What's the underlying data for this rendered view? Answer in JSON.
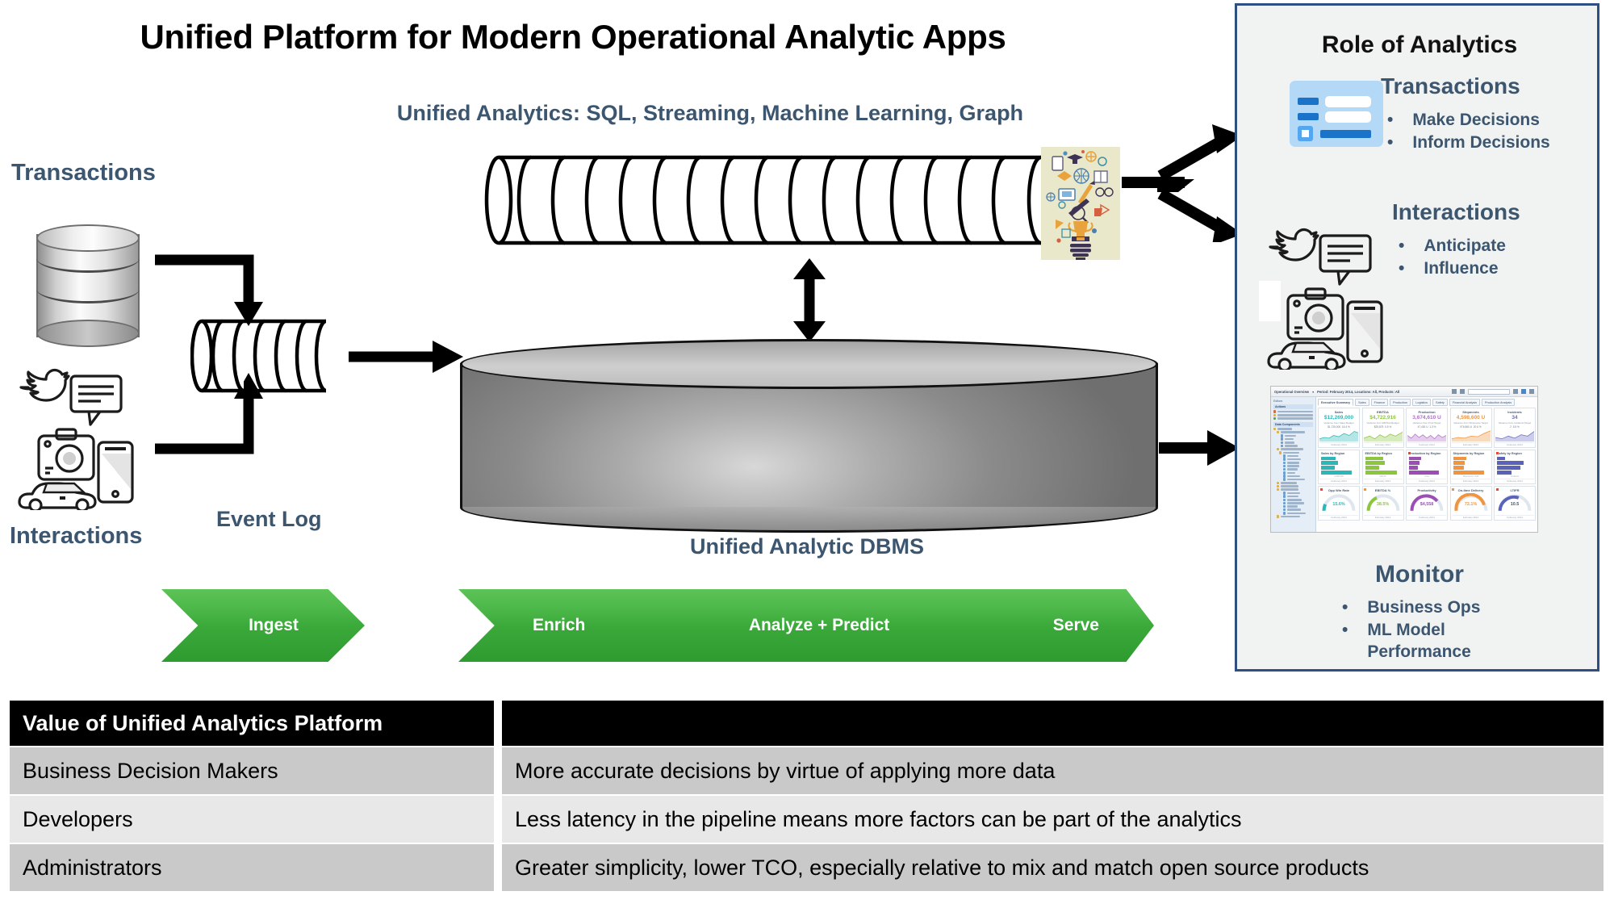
{
  "title": "Unified Platform for Modern Operational Analytic Apps",
  "subtitle": "Unified Analytics: SQL, Streaming, Machine Learning, Graph",
  "flow": {
    "transactions_label": "Transactions",
    "interactions_label": "Interactions",
    "event_log_label": "Event Log",
    "dbms_label": "Unified Analytic DBMS",
    "transactions_icon": "database-cylinder-icon",
    "interactions_icon": "social-devices-cluster-icon",
    "event_log_icon": "coiled-pipe-icon",
    "stream_pipe_icon": "long-coiled-pipe-icon",
    "insight_icon": "lightbulb-ideas-collage-icon",
    "dbms_icon": "large-drum-database-icon"
  },
  "pipeline": {
    "ingest": "Ingest",
    "stages": [
      "Enrich",
      "Analyze + Predict",
      "Serve"
    ]
  },
  "role_panel": {
    "title": "Role of Analytics",
    "sections": [
      {
        "heading": "Transactions",
        "icon": "form-card-icon",
        "bullets": [
          "Make Decisions",
          "Inform Decisions"
        ]
      },
      {
        "heading": "Interactions",
        "icon": "social-devices-cluster-icon",
        "bullets": [
          "Anticipate",
          "Influence"
        ]
      },
      {
        "heading": "Monitor",
        "icon": "dashboard-screenshot-icon",
        "bullets": [
          "Business Ops",
          "ML Model Performance"
        ]
      }
    ]
  },
  "dashboard": {
    "titlebar": "Operational Overview",
    "titlebar_filter": "Period: February 2014, Locations: All, Products: All",
    "search_placeholder": "Search Company",
    "sidebar_title": "Editors",
    "sidebar_groups": [
      {
        "name": "Actions",
        "items": [
          "Copy to Personal Folder",
          "Copy to common folder ...",
          "Publish this component"
        ]
      },
      {
        "name": "Data Components",
        "items": [
          "Metrics",
          "Worldwide Operations Metrics",
          "Quantity",
          "Price",
          "Costs",
          "New LotR",
          "Stepwise World Metrics",
          "Sales Metrics",
          "Backlog",
          "Enquiry Count",
          "Lead Count",
          "Quote Count",
          "Sale Count",
          "Sales",
          "Sales Active",
          "Sales Success Rate",
          "Safety Metrics",
          "Finance Metrics",
          "Logistics Metrics",
          "Deliveries",
          "Inventory",
          "Inventory Days",
          "On-time Deliveries",
          "OTD Target",
          "Shipments",
          "On Time Delivery Rate",
          "Production Metrics"
        ]
      }
    ],
    "tabs": [
      "Executive Summary",
      "Sales",
      "Finance",
      "Production",
      "Logistics",
      "Safety",
      "Financial Analysis",
      "Production Analysis"
    ],
    "active_tab": "Executive Summary",
    "period_label": "February 2014",
    "kpis": [
      {
        "name": "Sales",
        "value": "$12,269,000",
        "color": "#2bb7b7",
        "variance_label": "Variance from Sales Budget",
        "variance_value": "$1,725,000",
        "variance_pct": "16.4 %"
      },
      {
        "name": "EBITDA",
        "value": "$4,722,916",
        "color": "#8cc63f",
        "variance_label": "Variance from EBITDA Budget",
        "variance_value": "$25,875",
        "variance_pct": "0.5 %"
      },
      {
        "name": "Production",
        "value": "3,674,610 U",
        "color": "#b06fc7",
        "variance_label": "Variance from Prod Target",
        "variance_value": "47,430 U",
        "variance_pct": "1.3 %"
      },
      {
        "name": "Shipments",
        "value": "4,598,600 U",
        "color": "#f0953f",
        "variance_label": "Variance from Shipments Target",
        "variance_value": "976,560 U",
        "variance_pct": "20.6 %"
      },
      {
        "name": "Incidents",
        "value": "34",
        "color": "#6a6fc4",
        "variance_label": "Variance from Incidents Target",
        "variance_value": "2",
        "variance_pct": "5.5 %"
      }
    ],
    "region_charts": [
      {
        "name": "Sales by Region",
        "color": "#2bb7b7",
        "bars": [
          42,
          48,
          38,
          86
        ],
        "axis": "2,000,000"
      },
      {
        "name": "EBITDA by Region",
        "color": "#8cc63f",
        "bars": [
          50,
          56,
          40,
          90
        ],
        "axis": "500,00"
      },
      {
        "name": "Production by Region",
        "color": "#9b4fb5",
        "bars": [
          34,
          30,
          26,
          84
        ],
        "axis": "Units"
      },
      {
        "name": "Shipments by Region",
        "color": "#f0953f",
        "bars": [
          38,
          34,
          30,
          88
        ],
        "axis": "Shipments x 100"
      },
      {
        "name": "Safety by Region",
        "color": "#5b62ba",
        "bars": [
          22,
          74,
          66,
          40
        ],
        "axis": "Incidents"
      }
    ],
    "gauges": [
      {
        "name": "Opp Win Rate",
        "value": "15.6%",
        "color": "#2bb7b7",
        "pct": 16
      },
      {
        "name": "EBITDA %",
        "value": "38.5%",
        "color": "#8cc63f",
        "pct": 39
      },
      {
        "name": "Productivity",
        "value": "$4,558",
        "color": "#9b4fb5",
        "pct": 62
      },
      {
        "name": "On-time Delivery",
        "value": "72.1%",
        "color": "#f0953f",
        "pct": 72
      },
      {
        "name": "LTIFR",
        "value": "10.5",
        "color": "#5b62ba",
        "pct": 55
      }
    ]
  },
  "table": {
    "header": [
      "Value of Unified Analytics Platform",
      ""
    ],
    "rows": [
      [
        "Business Decision Makers",
        "More accurate decisions by virtue of applying more data"
      ],
      [
        "Developers",
        "Less latency in the pipeline means more factors can be part of the analytics"
      ],
      [
        "Administrators",
        "Greater simplicity, lower TCO, especially relative to mix and match open source products"
      ]
    ]
  },
  "colors": {
    "slate_text": "#3d5670",
    "panel_border": "#2f4f82",
    "panel_bg": "#f1f2f2",
    "chevron_green": "#3aa93a",
    "card_blue": "#b3d9f7",
    "accent_blue": "#1a73c8"
  }
}
